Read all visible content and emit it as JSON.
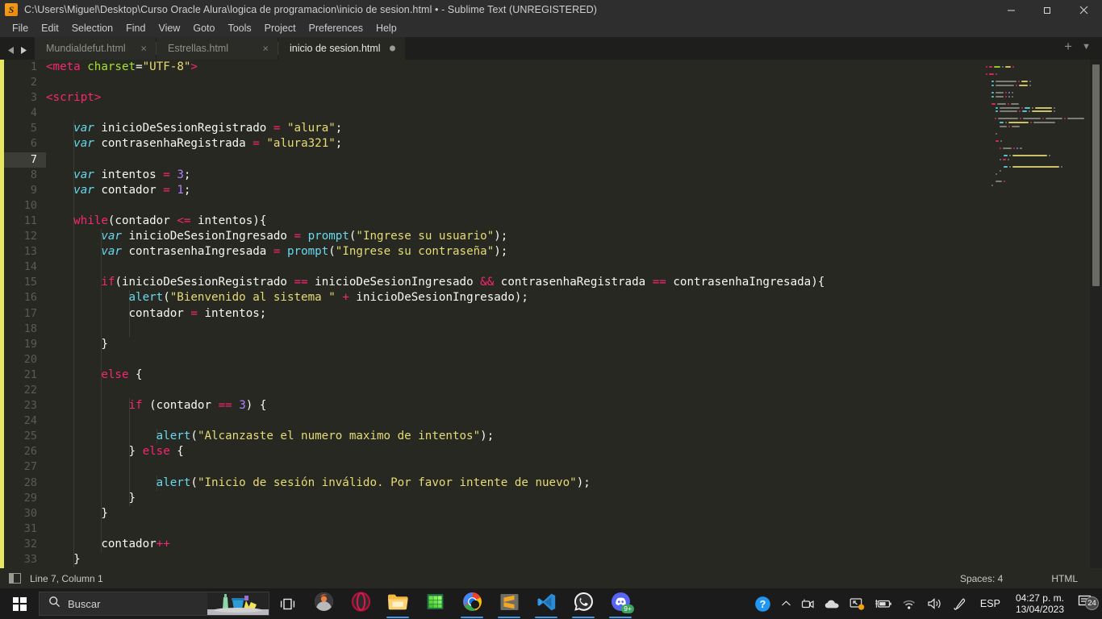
{
  "window": {
    "title": "C:\\Users\\Miguel\\Desktop\\Curso Oracle Alura\\logica de programacion\\inicio de sesion.html • - Sublime Text (UNREGISTERED)",
    "app_icon": "sublime-text-icon",
    "controls": {
      "minimize": "minimize-icon",
      "restore": "restore-icon",
      "close": "close-icon"
    }
  },
  "menu": {
    "items": [
      {
        "label": "File"
      },
      {
        "label": "Edit"
      },
      {
        "label": "Selection"
      },
      {
        "label": "Find"
      },
      {
        "label": "View"
      },
      {
        "label": "Goto"
      },
      {
        "label": "Tools"
      },
      {
        "label": "Project"
      },
      {
        "label": "Preferences"
      },
      {
        "label": "Help"
      }
    ]
  },
  "tabs": {
    "nav_prev": "chevron-left-icon",
    "nav_next": "chevron-right-icon",
    "items": [
      {
        "label": "Mundialdefut.html",
        "active": false,
        "modified": false,
        "close": "×"
      },
      {
        "label": "Estrellas.html",
        "active": false,
        "modified": false,
        "close": "×"
      },
      {
        "label": "inicio de sesion.html",
        "active": true,
        "modified": true,
        "close": "×"
      }
    ],
    "new_tab": "+",
    "tab_menu": "▼"
  },
  "editor": {
    "active_line": 7,
    "lines": [
      {
        "n": 1,
        "tokens": [
          {
            "t": "<",
            "c": "k-tag"
          },
          {
            "t": "meta",
            "c": "k-tag"
          },
          {
            "t": " ",
            "c": "k-plain"
          },
          {
            "t": "charset",
            "c": "k-attr"
          },
          {
            "t": "=",
            "c": "k-plain"
          },
          {
            "t": "\"UTF-8\"",
            "c": "k-str"
          },
          {
            "t": ">",
            "c": "k-tag"
          }
        ],
        "indent": 0
      },
      {
        "n": 2,
        "tokens": [],
        "indent": 0
      },
      {
        "n": 3,
        "tokens": [
          {
            "t": "<",
            "c": "k-tag"
          },
          {
            "t": "script",
            "c": "k-tag"
          },
          {
            "t": ">",
            "c": "k-tag"
          }
        ],
        "indent": 0
      },
      {
        "n": 4,
        "tokens": [],
        "indent": 0
      },
      {
        "n": 5,
        "tokens": [
          {
            "t": "    ",
            "c": "k-plain"
          },
          {
            "t": "var",
            "c": "k-var"
          },
          {
            "t": " inicioDeSesionRegistrado ",
            "c": "k-plain"
          },
          {
            "t": "=",
            "c": "k-kw"
          },
          {
            "t": " ",
            "c": "k-plain"
          },
          {
            "t": "\"alura\"",
            "c": "k-str"
          },
          {
            "t": ";",
            "c": "k-plain"
          }
        ],
        "indent": 1
      },
      {
        "n": 6,
        "tokens": [
          {
            "t": "    ",
            "c": "k-plain"
          },
          {
            "t": "var",
            "c": "k-var"
          },
          {
            "t": " contrasenhaRegistrada ",
            "c": "k-plain"
          },
          {
            "t": "=",
            "c": "k-kw"
          },
          {
            "t": " ",
            "c": "k-plain"
          },
          {
            "t": "\"alura321\"",
            "c": "k-str"
          },
          {
            "t": ";",
            "c": "k-plain"
          }
        ],
        "indent": 1
      },
      {
        "n": 7,
        "tokens": [],
        "indent": 1
      },
      {
        "n": 8,
        "tokens": [
          {
            "t": "    ",
            "c": "k-plain"
          },
          {
            "t": "var",
            "c": "k-var"
          },
          {
            "t": " intentos ",
            "c": "k-plain"
          },
          {
            "t": "=",
            "c": "k-kw"
          },
          {
            "t": " ",
            "c": "k-plain"
          },
          {
            "t": "3",
            "c": "k-num"
          },
          {
            "t": ";",
            "c": "k-plain"
          }
        ],
        "indent": 1
      },
      {
        "n": 9,
        "tokens": [
          {
            "t": "    ",
            "c": "k-plain"
          },
          {
            "t": "var",
            "c": "k-var"
          },
          {
            "t": " contador ",
            "c": "k-plain"
          },
          {
            "t": "=",
            "c": "k-kw"
          },
          {
            "t": " ",
            "c": "k-plain"
          },
          {
            "t": "1",
            "c": "k-num"
          },
          {
            "t": ";",
            "c": "k-plain"
          }
        ],
        "indent": 1
      },
      {
        "n": 10,
        "tokens": [],
        "indent": 1
      },
      {
        "n": 11,
        "tokens": [
          {
            "t": "    ",
            "c": "k-plain"
          },
          {
            "t": "while",
            "c": "k-kw"
          },
          {
            "t": "(contador ",
            "c": "k-plain"
          },
          {
            "t": "<=",
            "c": "k-kw"
          },
          {
            "t": " intentos){",
            "c": "k-plain"
          }
        ],
        "indent": 1
      },
      {
        "n": 12,
        "tokens": [
          {
            "t": "        ",
            "c": "k-plain"
          },
          {
            "t": "var",
            "c": "k-var"
          },
          {
            "t": " inicioDeSesionIngresado ",
            "c": "k-plain"
          },
          {
            "t": "=",
            "c": "k-kw"
          },
          {
            "t": " ",
            "c": "k-plain"
          },
          {
            "t": "prompt",
            "c": "k-fn"
          },
          {
            "t": "(",
            "c": "k-plain"
          },
          {
            "t": "\"Ingrese su usuario\"",
            "c": "k-str"
          },
          {
            "t": ");",
            "c": "k-plain"
          }
        ],
        "indent": 2
      },
      {
        "n": 13,
        "tokens": [
          {
            "t": "        ",
            "c": "k-plain"
          },
          {
            "t": "var",
            "c": "k-var"
          },
          {
            "t": " contrasenhaIngresada ",
            "c": "k-plain"
          },
          {
            "t": "=",
            "c": "k-kw"
          },
          {
            "t": " ",
            "c": "k-plain"
          },
          {
            "t": "prompt",
            "c": "k-fn"
          },
          {
            "t": "(",
            "c": "k-plain"
          },
          {
            "t": "\"Ingrese su contraseña\"",
            "c": "k-str"
          },
          {
            "t": ");",
            "c": "k-plain"
          }
        ],
        "indent": 2
      },
      {
        "n": 14,
        "tokens": [],
        "indent": 2
      },
      {
        "n": 15,
        "tokens": [
          {
            "t": "        ",
            "c": "k-plain"
          },
          {
            "t": "if",
            "c": "k-kw"
          },
          {
            "t": "(inicioDeSesionRegistrado ",
            "c": "k-plain"
          },
          {
            "t": "==",
            "c": "k-kw"
          },
          {
            "t": " inicioDeSesionIngresado ",
            "c": "k-plain"
          },
          {
            "t": "&&",
            "c": "k-kw"
          },
          {
            "t": " contrasenhaRegistrada ",
            "c": "k-plain"
          },
          {
            "t": "==",
            "c": "k-kw"
          },
          {
            "t": " contrasenhaIngresada){",
            "c": "k-plain"
          }
        ],
        "indent": 2
      },
      {
        "n": 16,
        "tokens": [
          {
            "t": "            ",
            "c": "k-plain"
          },
          {
            "t": "alert",
            "c": "k-fn"
          },
          {
            "t": "(",
            "c": "k-plain"
          },
          {
            "t": "\"Bienvenido al sistema \"",
            "c": "k-str"
          },
          {
            "t": " ",
            "c": "k-plain"
          },
          {
            "t": "+",
            "c": "k-kw"
          },
          {
            "t": " inicioDeSesionIngresado);",
            "c": "k-plain"
          }
        ],
        "indent": 3
      },
      {
        "n": 17,
        "tokens": [
          {
            "t": "            contador ",
            "c": "k-plain"
          },
          {
            "t": "=",
            "c": "k-kw"
          },
          {
            "t": " intentos;",
            "c": "k-plain"
          }
        ],
        "indent": 3
      },
      {
        "n": 18,
        "tokens": [],
        "indent": 3
      },
      {
        "n": 19,
        "tokens": [
          {
            "t": "        }",
            "c": "k-plain"
          }
        ],
        "indent": 2
      },
      {
        "n": 20,
        "tokens": [],
        "indent": 2
      },
      {
        "n": 21,
        "tokens": [
          {
            "t": "        ",
            "c": "k-plain"
          },
          {
            "t": "else",
            "c": "k-kw"
          },
          {
            "t": " {",
            "c": "k-plain"
          }
        ],
        "indent": 2
      },
      {
        "n": 22,
        "tokens": [],
        "indent": 2
      },
      {
        "n": 23,
        "tokens": [
          {
            "t": "            ",
            "c": "k-plain"
          },
          {
            "t": "if",
            "c": "k-kw"
          },
          {
            "t": " (contador ",
            "c": "k-plain"
          },
          {
            "t": "==",
            "c": "k-kw"
          },
          {
            "t": " ",
            "c": "k-plain"
          },
          {
            "t": "3",
            "c": "k-num"
          },
          {
            "t": ") {",
            "c": "k-plain"
          }
        ],
        "indent": 3
      },
      {
        "n": 24,
        "tokens": [],
        "indent": 3
      },
      {
        "n": 25,
        "tokens": [
          {
            "t": "                ",
            "c": "k-plain"
          },
          {
            "t": "alert",
            "c": "k-fn"
          },
          {
            "t": "(",
            "c": "k-plain"
          },
          {
            "t": "\"Alcanzaste el numero maximo de intentos\"",
            "c": "k-str"
          },
          {
            "t": ");",
            "c": "k-plain"
          }
        ],
        "indent": 4
      },
      {
        "n": 26,
        "tokens": [
          {
            "t": "            } ",
            "c": "k-plain"
          },
          {
            "t": "else",
            "c": "k-kw"
          },
          {
            "t": " {",
            "c": "k-plain"
          }
        ],
        "indent": 3
      },
      {
        "n": 27,
        "tokens": [],
        "indent": 3
      },
      {
        "n": 28,
        "tokens": [
          {
            "t": "                ",
            "c": "k-plain"
          },
          {
            "t": "alert",
            "c": "k-fn"
          },
          {
            "t": "(",
            "c": "k-plain"
          },
          {
            "t": "\"Inicio de sesión inválido. Por favor intente de nuevo\"",
            "c": "k-str"
          },
          {
            "t": ");",
            "c": "k-plain"
          }
        ],
        "indent": 4
      },
      {
        "n": 29,
        "tokens": [
          {
            "t": "            }",
            "c": "k-plain"
          }
        ],
        "indent": 3
      },
      {
        "n": 30,
        "tokens": [
          {
            "t": "        }",
            "c": "k-plain"
          }
        ],
        "indent": 2
      },
      {
        "n": 31,
        "tokens": [],
        "indent": 2
      },
      {
        "n": 32,
        "tokens": [
          {
            "t": "        contador",
            "c": "k-plain"
          },
          {
            "t": "++",
            "c": "k-kw"
          }
        ],
        "indent": 2
      },
      {
        "n": 33,
        "tokens": [
          {
            "t": "    }",
            "c": "k-plain"
          }
        ],
        "indent": 1
      }
    ]
  },
  "statusbar": {
    "sidebar_toggle": "sidebar-toggle-icon",
    "cursor_position": "Line 7, Column 1",
    "indentation": "Spaces: 4",
    "syntax": "HTML"
  },
  "taskbar": {
    "start": "windows-logo-icon",
    "search": {
      "placeholder": "Buscar",
      "icon": "search-icon"
    },
    "task_view": "task-view-icon",
    "apps": [
      {
        "name": "firefox-icon",
        "running": false
      },
      {
        "name": "opera-icon",
        "running": false
      },
      {
        "name": "file-explorer-icon",
        "running": true
      },
      {
        "name": "excel-icon",
        "running": false
      },
      {
        "name": "chrome-icon",
        "running": true
      },
      {
        "name": "sublime-text-icon",
        "running": true
      },
      {
        "name": "vscode-icon",
        "running": true
      },
      {
        "name": "whatsapp-icon",
        "running": true
      },
      {
        "name": "discord-icon",
        "running": true,
        "badge": "9+"
      }
    ],
    "tray": {
      "help": "help-circle-icon",
      "chevron": "chevron-up-icon",
      "camera": "camera-icon",
      "onedrive": "cloud-icon",
      "display": "display-icon",
      "battery": "battery-icon",
      "wifi": "wifi-icon",
      "volume": "volume-icon",
      "pen": "pen-icon",
      "language": "ESP",
      "time": "04:27 p. m.",
      "date": "13/04/2023",
      "notifications": "notification-icon",
      "notification_count": "24"
    }
  },
  "colors": {
    "editor_bg": "#272822",
    "chrome_bg": "#2e2e2e",
    "tabbar_bg": "#1e1f1c",
    "accent_yellow": "#e6db74",
    "accent_pink": "#f92672",
    "accent_cyan": "#66d9ef",
    "accent_green": "#a6e22e",
    "accent_purple": "#ae81ff",
    "taskbar_bg": "#1b1b1b"
  }
}
